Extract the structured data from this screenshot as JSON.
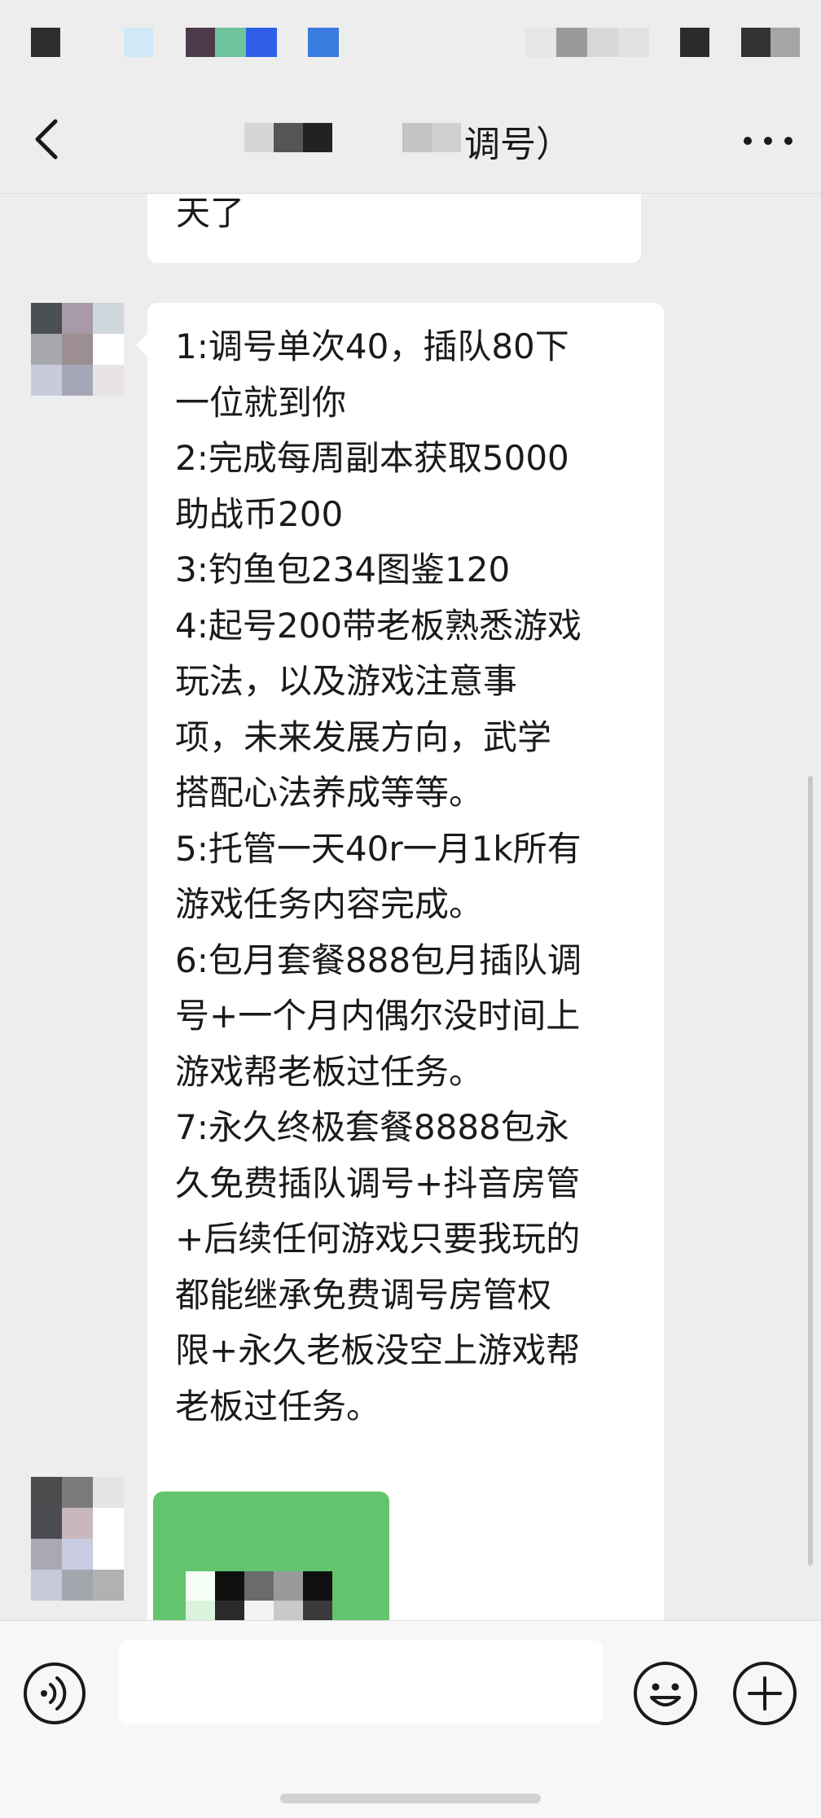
{
  "header": {
    "title_suffix": "调号）"
  },
  "chat": {
    "prev_message_tail": "天了",
    "main_message_lines": [
      "1:调号单次40，插队80下",
      "一位就到你",
      "2:完成每周副本获取5000",
      "助战币200",
      "3:钓鱼包234图鉴120",
      "4:起号200带老板熟悉游戏",
      "玩法，以及游戏注意事",
      "项，未来发展方向，武学",
      "搭配心法养成等等。",
      "5:托管一天40r一月1k所有",
      "游戏任务内容完成。",
      "6:包月套餐888包月插队调",
      "号+一个月内偶尔没时间上",
      "游戏帮老板过任务。",
      "7:永久终极套餐8888包永",
      "久免费插队调号+抖音房管",
      "+后续任何游戏只要我玩的",
      "都能继承免费调号房管权",
      "限+永久老板没空上游戏帮",
      "老板过任务。"
    ]
  },
  "input": {
    "value": "",
    "placeholder": ""
  },
  "icons": {
    "back": "chevron-left-icon",
    "more": "more-dots-icon",
    "voice": "voice-icon",
    "emoji": "emoji-icon",
    "plus": "plus-icon"
  },
  "colors": {
    "background": "#ededed",
    "bubble": "#ffffff",
    "sent_bubble": "#62c46d"
  }
}
